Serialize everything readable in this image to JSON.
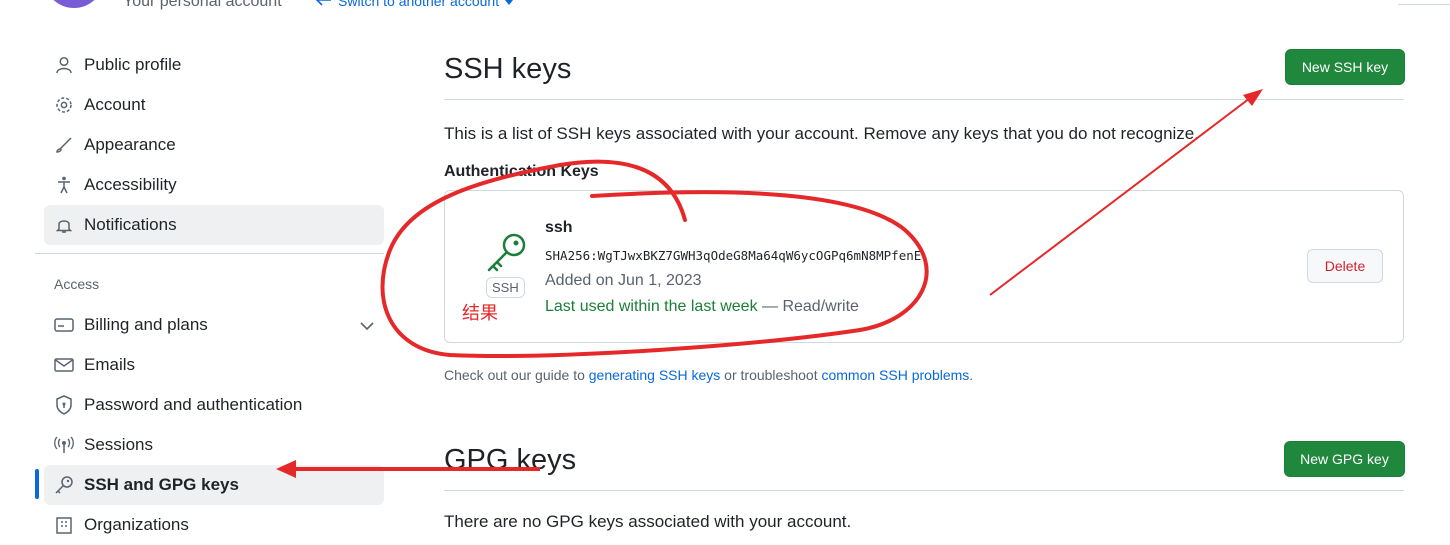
{
  "header": {
    "account_label": "Your personal account",
    "switch_link": "Switch to another account"
  },
  "sidebar": {
    "items": [
      {
        "label": "Public profile",
        "icon": "person-icon"
      },
      {
        "label": "Account",
        "icon": "gear-icon"
      },
      {
        "label": "Appearance",
        "icon": "paintbrush-icon"
      },
      {
        "label": "Accessibility",
        "icon": "accessibility-icon"
      },
      {
        "label": "Notifications",
        "icon": "bell-icon"
      }
    ],
    "access_section_title": "Access",
    "access_items": [
      {
        "label": "Billing and plans",
        "icon": "credit-card-icon"
      },
      {
        "label": "Emails",
        "icon": "mail-icon"
      },
      {
        "label": "Password and authentication",
        "icon": "shield-lock-icon"
      },
      {
        "label": "Sessions",
        "icon": "broadcast-icon"
      },
      {
        "label": "SSH and GPG keys",
        "icon": "key-icon"
      },
      {
        "label": "Organizations",
        "icon": "organization-icon"
      }
    ]
  },
  "ssh": {
    "title": "SSH keys",
    "new_button": "New SSH key",
    "description": "This is a list of SSH keys associated with your account. Remove any keys that you do not recognize.",
    "auth_heading": "Authentication Keys",
    "key": {
      "name": "ssh",
      "badge": "SSH",
      "fingerprint": "SHA256:WgTJwxBKZ7GWH3qOdeG8Ma64qW6ycOGPq6mN8MPfenE",
      "added": "Added on Jun 1, 2023",
      "last_used": "Last used within the last week",
      "access": " — Read/write",
      "delete_button": "Delete"
    },
    "help": {
      "prefix": "Check out our guide to ",
      "link1": "generating SSH keys",
      "middle": " or troubleshoot ",
      "link2": "common SSH problems",
      "suffix": "."
    }
  },
  "gpg": {
    "title": "GPG keys",
    "new_button": "New GPG key",
    "description": "There are no GPG keys associated with your account."
  },
  "annotation": {
    "note": "结果",
    "color": "#e5292a"
  },
  "colors": {
    "primary_green": "#1f883d",
    "link_blue": "#0969da",
    "danger_red": "#d1242f",
    "muted": "#59636e"
  }
}
